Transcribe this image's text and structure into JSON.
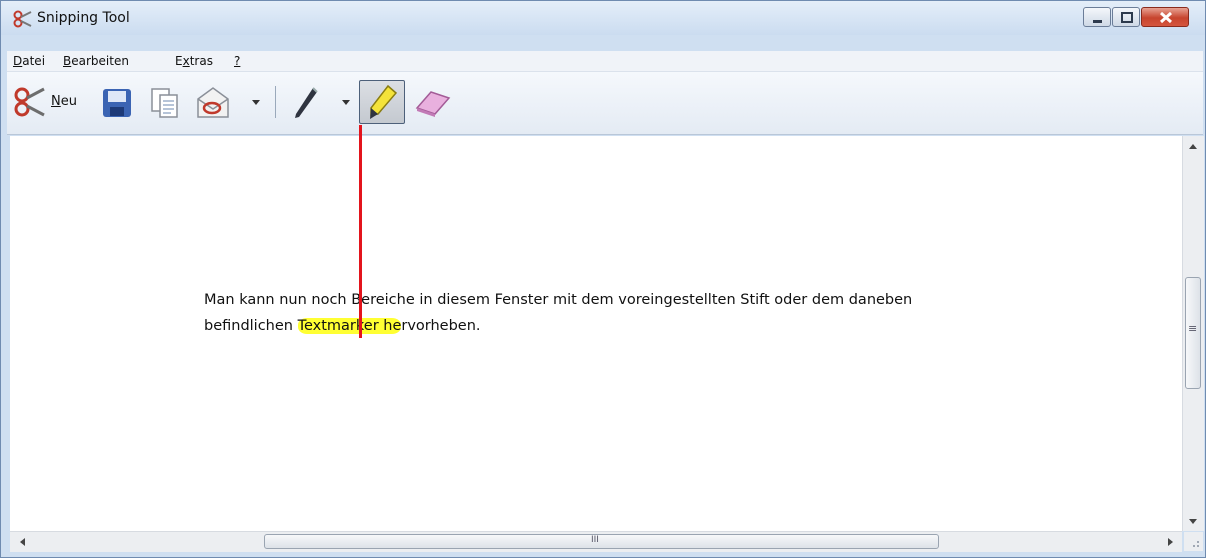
{
  "window": {
    "title": "Snipping Tool"
  },
  "menu": {
    "file": {
      "accel": "D",
      "rest": "atei"
    },
    "edit": {
      "accel": "B",
      "rest": "earbeiten"
    },
    "extras": {
      "pre": "E",
      "accel": "x",
      "rest": "tras"
    },
    "help": {
      "accel": "?"
    }
  },
  "toolbar": {
    "new_accel": "N",
    "new_rest": "eu"
  },
  "document": {
    "line1": "Man kann nun noch Bereiche in diesem Fenster mit dem voreingestellten Stift oder dem daneben",
    "line2_before": "befindlichen ",
    "line2_highlight": "Textmarker he",
    "line2_after": "rvorheben."
  },
  "scrollbar": {
    "grip": "≡",
    "hgrip": "III"
  },
  "colors": {
    "highlight": "#ffff33",
    "annotation_line": "#e3141c",
    "close_button": "#c7442e"
  }
}
